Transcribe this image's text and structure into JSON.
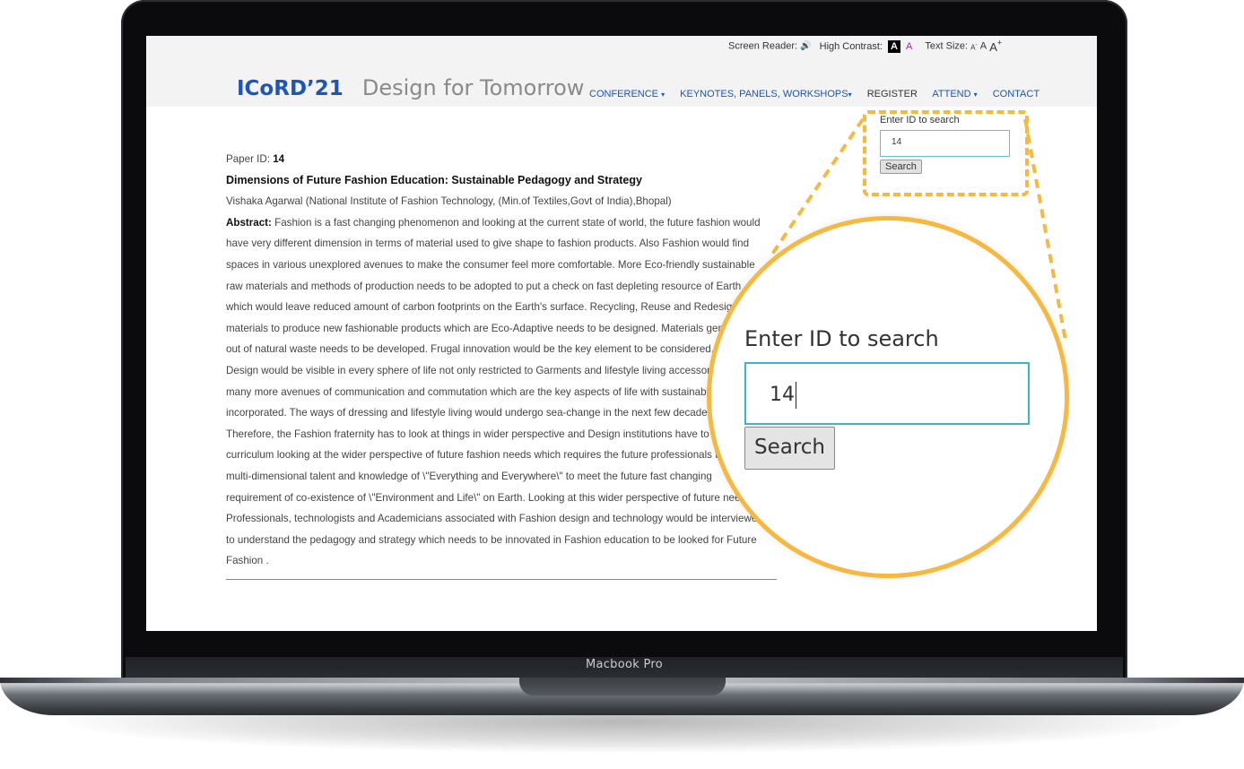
{
  "device": {
    "label": "Macbook Pro"
  },
  "accessibility": {
    "screen_reader_label": "Screen Reader:",
    "screen_reader_icon": "speaker-icon",
    "high_contrast_label": "High Contrast:",
    "contrast_black": "A",
    "contrast_white": "A",
    "text_size_label": "Text Size:",
    "size_small": "A",
    "size_small_suffix": "-",
    "size_medium": "A",
    "size_large": "A",
    "size_large_suffix": "+"
  },
  "site": {
    "logo": "ICoRD’21",
    "tagline": "Design for Tomorrow"
  },
  "nav": {
    "conference": "CONFERENCE",
    "keynotes": "KEYNOTES, PANELS, WORKSHOPS",
    "register": "REGISTER",
    "attend": "ATTEND",
    "contact": "CONTACT",
    "caret": "▾"
  },
  "paper": {
    "id_label": "Paper ID:",
    "id_value": "14",
    "title": "Dimensions of Future Fashion Education: Sustainable Pedagogy and Strategy",
    "authors": "Vishaka Agarwal (National Institute of Fashion Technology, (Min.of Textiles,Govt of India),Bhopal)",
    "abstract_label": "Abstract:",
    "abstract_p1": "Fashion is a fast changing phenomenon and looking at the current state of world, the future fashion would have very different dimension in terms of material used to give shape to fashion products. Also Fashion would find spaces in various unexplored avenues to make the consumer feel more comfortable. More Eco-friendly sustainable raw materials and methods of production needs to be adopted to put a check on fast depleting resource of Earth which would leave reduced amount of carbon footprints on the Earth's surface. Recycling, Reuse and Redesign of materials to produce new fashionable products which are Eco-Adaptive needs to be designed. Materials generated out of natural waste needs to be developed. Frugal innovation would be the key element to be considered.",
    "abstract_p2": "Design would be visible in every sphere of life not only restricted to Garments and lifestyle living accessories but in many more avenues of communication and commutation which are the key aspects of life with sustainability incorporated. The ways of dressing and lifestyle living would undergo sea-change in the next few decades.",
    "abstract_p3": "Therefore, the Fashion fraternity has to look at things in wider perspective and Design institutions have to prepare curriculum looking at the wider perspective of future fashion needs which requires the future professionals to have multi-dimensional talent and knowledge of \\\"Everything and Everywhere\\\" to meet the future fast changing requirement of co-existence of \\\"Environment and Life\\\" on Earth. Looking at this wider perspective of future needs Professionals, technologists and Academicians associated with Fashion design and technology would be interviewed to understand the pedagogy and strategy which needs to be innovated in Fashion education to be looked for Future Fashion ."
  },
  "search": {
    "label": "Enter ID to search",
    "value": "14",
    "button": "Search"
  },
  "colors": {
    "brand_blue": "#1b56b8",
    "callout_yellow": "#f5b942",
    "input_border": "#3bb6c9"
  }
}
